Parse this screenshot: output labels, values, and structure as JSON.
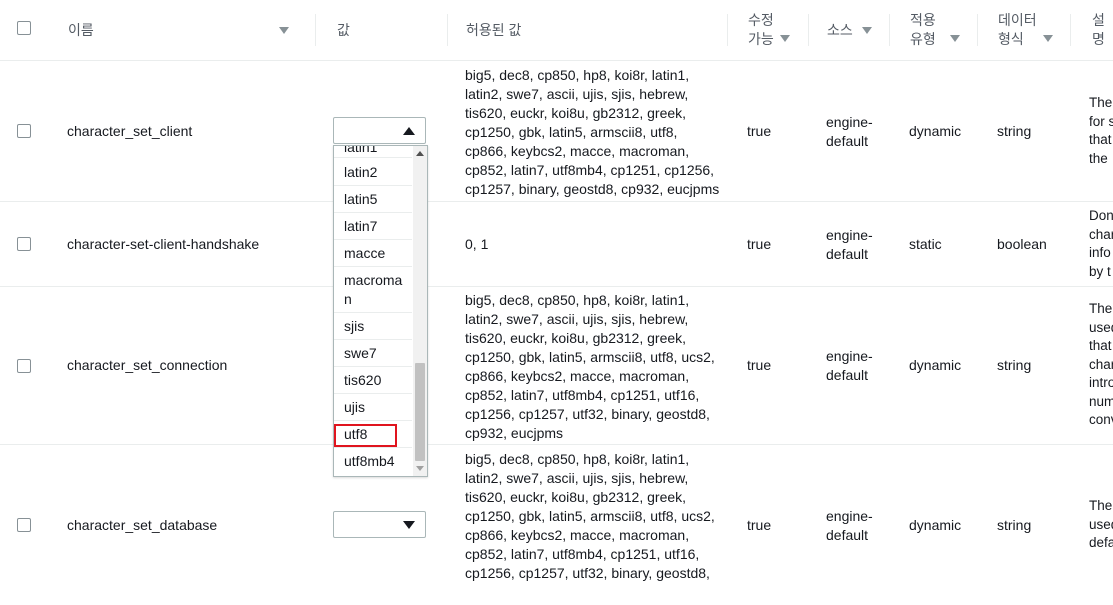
{
  "header": {
    "name": "이름",
    "value": "값",
    "allowed_values": "허용된 값",
    "modifiable_line1": "수정",
    "modifiable_line2": "가능",
    "source": "소스",
    "apply_type_line1": "적용",
    "apply_type_line2": "유형",
    "data_type_line1": "데이터",
    "data_type_line2": "형식",
    "description": "설명"
  },
  "rows": [
    {
      "name": "character_set_client",
      "allowed": "big5, dec8, cp850, hp8, koi8r, latin1, latin2, swe7, ascii, ujis, sjis, hebrew, tis620, euckr, koi8u, gb2312, greek, cp1250, gbk, latin5, armscii8, utf8, cp866, keybcs2, macce, macroman, cp852, latin7, utf8mb4, cp1251, cp1256, cp1257, binary, geostd8, cp932, eucjpms",
      "modifiable": "true",
      "source_1": "engine-",
      "source_2": "default",
      "apply_type": "dynamic",
      "data_type": "string",
      "desc": [
        "The",
        "for s",
        "that",
        "the"
      ]
    },
    {
      "name": "character-set-client-handshake",
      "allowed": "0, 1",
      "modifiable": "true",
      "source_1": "engine-",
      "source_2": "default",
      "apply_type": "static",
      "data_type": "boolean",
      "desc": [
        "Don",
        "char",
        "info",
        "by t"
      ]
    },
    {
      "name": "character_set_connection",
      "allowed": "big5, dec8, cp850, hp8, koi8r, latin1, latin2, swe7, ascii, ujis, sjis, hebrew, tis620, euckr, koi8u, gb2312, greek, cp1250, gbk, latin5, armscii8, utf8, ucs2, cp866, keybcs2, macce, macroman, cp852, latin7, utf8mb4, cp1251, utf16, cp1256, cp1257, utf32, binary, geostd8, cp932, eucjpms",
      "modifiable": "true",
      "source_1": "engine-",
      "source_2": "default",
      "apply_type": "dynamic",
      "data_type": "string",
      "desc": [
        "The",
        "used",
        "that",
        "char",
        "intro",
        "num",
        "conv"
      ]
    },
    {
      "name": "character_set_database",
      "allowed": "big5, dec8, cp850, hp8, koi8r, latin1, latin2, swe7, ascii, ujis, sjis, hebrew, tis620, euckr, koi8u, gb2312, greek, cp1250, gbk, latin5, armscii8, utf8, ucs2, cp866, keybcs2, macce, macroman, cp852, latin7, utf8mb4, cp1251, utf16, cp1256, cp1257, utf32, binary, geostd8,",
      "modifiable": "true",
      "source_1": "engine-",
      "source_2": "default",
      "apply_type": "dynamic",
      "data_type": "string",
      "desc": [
        "The",
        "used",
        "defa"
      ]
    }
  ],
  "dropdown": {
    "partial_top": "latin1",
    "options": [
      "latin2",
      "latin5",
      "latin7",
      "macce",
      "macroma\nn",
      "sjis",
      "swe7",
      "tis620",
      "ujis",
      "utf8",
      "utf8mb4"
    ],
    "highlighted": "utf8"
  },
  "colors": {
    "highlight_border": "#e0141e",
    "header_text": "#545b64",
    "row_border": "#eaeded"
  }
}
